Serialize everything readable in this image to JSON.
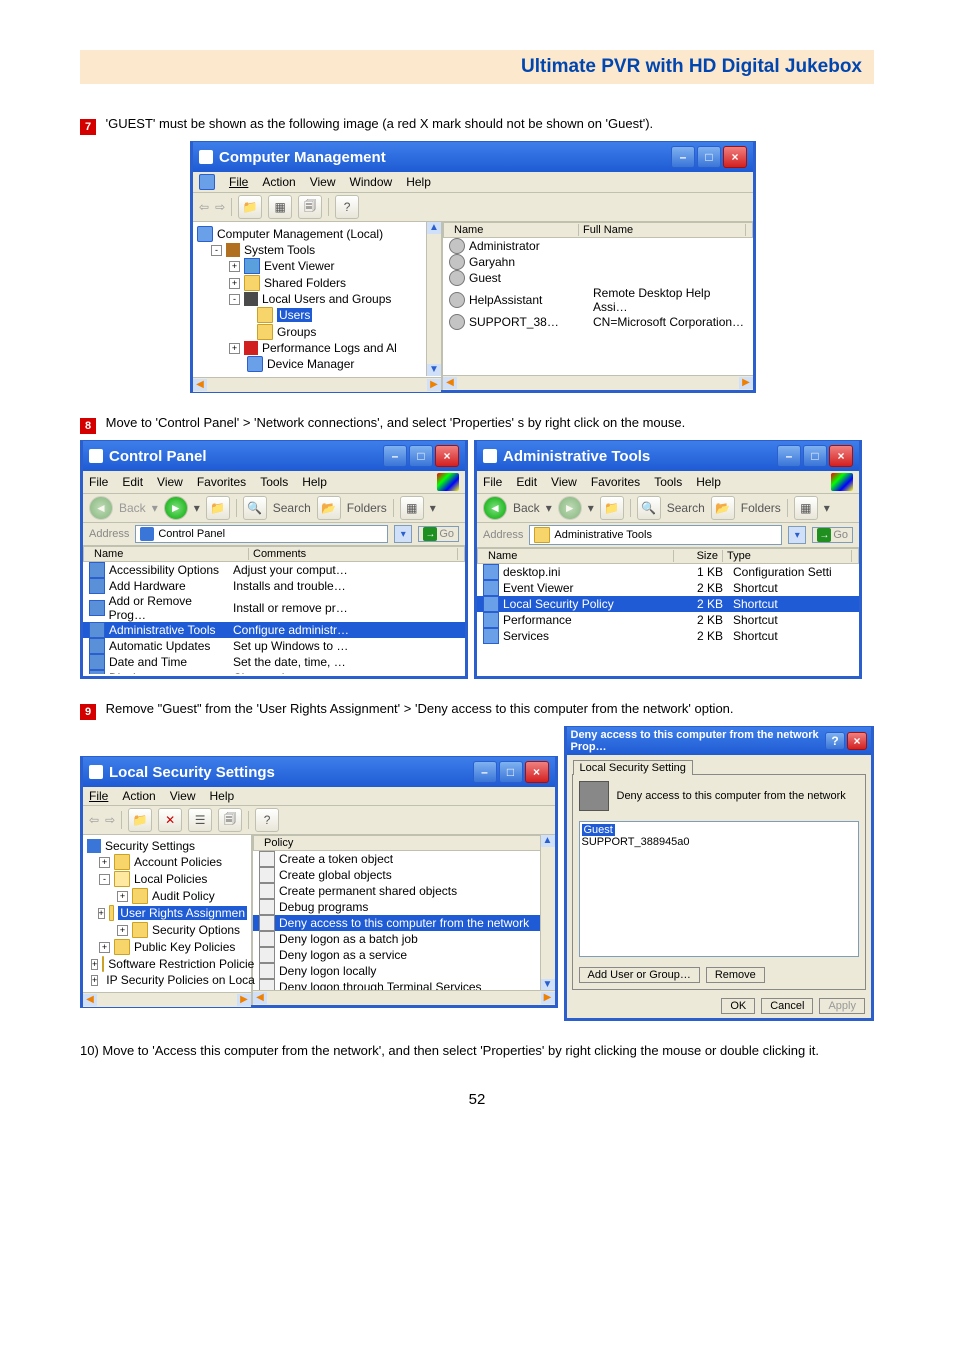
{
  "header": {
    "title": "Ultimate PVR with HD Digital Jukebox"
  },
  "page_number": "52",
  "step7": {
    "badge": "7",
    "text": "'GUEST' must be shown as the following image (a red X mark should not be shown on 'Guest')."
  },
  "cmwin": {
    "title": "Computer Management",
    "menus": {
      "file": "File",
      "action": "Action",
      "view": "View",
      "window": "Window",
      "help": "Help"
    },
    "tree": {
      "root": "Computer Management (Local)",
      "systools": "System Tools",
      "eventviewer": "Event Viewer",
      "shared": "Shared Folders",
      "lug": "Local Users and Groups",
      "users": "Users",
      "groups": "Groups",
      "perf": "Performance Logs and Al",
      "devmgr": "Device Manager"
    },
    "cols": {
      "name": "Name",
      "full": "Full Name"
    },
    "rows": [
      {
        "name": "Administrator",
        "full": ""
      },
      {
        "name": "Garyahn",
        "full": ""
      },
      {
        "name": "Guest",
        "full": ""
      },
      {
        "name": "HelpAssistant",
        "full": "Remote Desktop Help Assi…"
      },
      {
        "name": "SUPPORT_38…",
        "full": "CN=Microsoft Corporation…"
      }
    ]
  },
  "step8": {
    "badge": "8",
    "text": "Move to 'Control Panel' > 'Network connections', and select 'Properties' s by right click on the mouse."
  },
  "cpwin": {
    "title": "Control Panel",
    "menus": {
      "file": "File",
      "edit": "Edit",
      "view": "View",
      "fav": "Favorites",
      "tools": "Tools",
      "help": "Help"
    },
    "toolbar": {
      "back": "Back",
      "search": "Search",
      "folders": "Folders"
    },
    "addr_label": "Address",
    "addr_value": "Control Panel",
    "go": "Go",
    "cols": {
      "name": "Name",
      "comments": "Comments"
    },
    "rows": [
      {
        "n": "Accessibility Options",
        "c": "Adjust your comput…"
      },
      {
        "n": "Add Hardware",
        "c": "Installs and trouble…"
      },
      {
        "n": "Add or Remove Prog…",
        "c": "Install or remove pr…"
      },
      {
        "n": "Administrative Tools",
        "c": "Configure administr…",
        "sel": true
      },
      {
        "n": "Automatic Updates",
        "c": "Set up Windows to …"
      },
      {
        "n": "Date and Time",
        "c": "Set the date, time, …"
      },
      {
        "n": "Display",
        "c": "Change the appear…"
      }
    ]
  },
  "atwin": {
    "title": "Administrative Tools",
    "menus": {
      "file": "File",
      "edit": "Edit",
      "view": "View",
      "fav": "Favorites",
      "tools": "Tools",
      "help": "Help"
    },
    "toolbar": {
      "back": "Back",
      "search": "Search",
      "folders": "Folders"
    },
    "addr_label": "Address",
    "addr_value": "Administrative Tools",
    "go": "Go",
    "cols": {
      "name": "Name",
      "size": "Size",
      "type": "Type"
    },
    "rows": [
      {
        "n": "desktop.ini",
        "s": "1 KB",
        "t": "Configuration Setti"
      },
      {
        "n": "Event Viewer",
        "s": "2 KB",
        "t": "Shortcut"
      },
      {
        "n": "Local Security Policy",
        "s": "2 KB",
        "t": "Shortcut",
        "sel": true
      },
      {
        "n": "Performance",
        "s": "2 KB",
        "t": "Shortcut"
      },
      {
        "n": "Services",
        "s": "2 KB",
        "t": "Shortcut"
      }
    ]
  },
  "step9": {
    "badge": "9",
    "text": "Remove \"Guest\" from the 'User Rights Assignment' > 'Deny access to this computer from the network' option."
  },
  "lsswin": {
    "title": "Local Security Settings",
    "menus": {
      "file": "File",
      "action": "Action",
      "view": "View",
      "help": "Help"
    },
    "tree": {
      "root": "Security Settings",
      "acct": "Account Policies",
      "local": "Local Policies",
      "audit": "Audit Policy",
      "ura": "User Rights Assignmen",
      "secopt": "Security Options",
      "pkp": "Public Key Policies",
      "srp": "Software Restriction Policie",
      "ipsec": "IP Security Policies on Loca"
    },
    "colpolicy": "Policy",
    "policies": [
      "Create a token object",
      "Create global objects",
      "Create permanent shared objects",
      "Debug programs",
      "Deny access to this computer from the network",
      "Deny logon as a batch job",
      "Deny logon as a service",
      "Deny logon locally",
      "Deny logon through Terminal Services"
    ],
    "policies_sel_index": 4
  },
  "dlg": {
    "title": "Deny access to this computer from the network Prop…",
    "tab": "Local Security Setting",
    "heading": "Deny access to this computer from the network",
    "entries": [
      "Guest",
      "SUPPORT_388945a0"
    ],
    "sel_index": 0,
    "btn_add": "Add User or Group…",
    "btn_remove": "Remove",
    "ok": "OK",
    "cancel": "Cancel",
    "apply": "Apply"
  },
  "step10": {
    "text": "10) Move to 'Access this computer from the network', and then select 'Properties' by right clicking the mouse or double clicking it."
  }
}
